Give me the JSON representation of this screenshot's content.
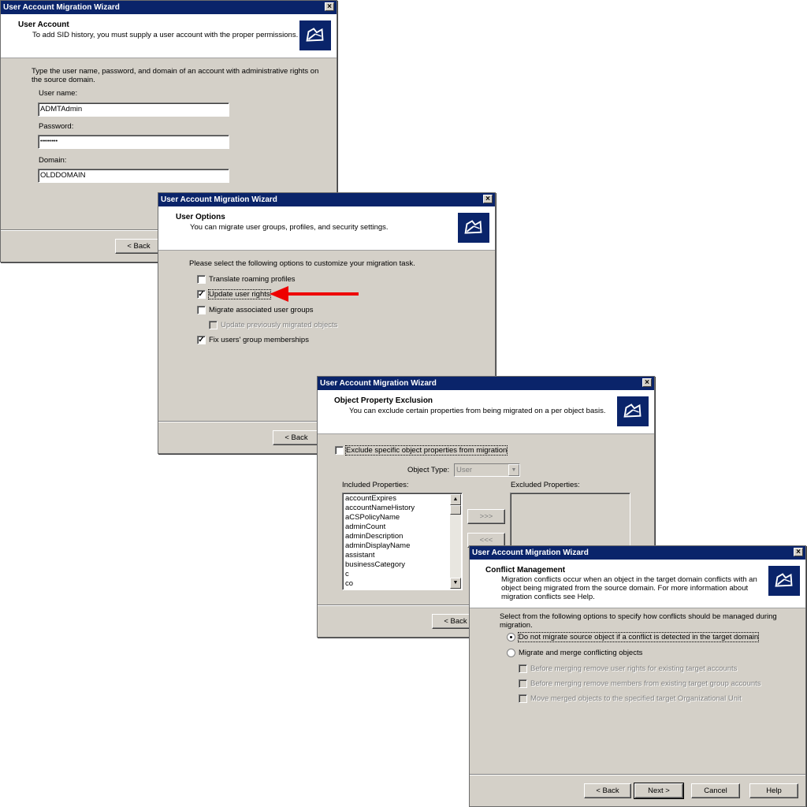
{
  "wizard_title": "User Account Migration Wizard",
  "close_glyph": "×",
  "accent_colors": {
    "titlebar": "#0a246a",
    "arrow": "#ee0000"
  },
  "win1": {
    "header_title": "User Account",
    "header_subtitle": "To add SID history, you must supply a user account with the proper permissions.",
    "instructions_line1": "Type the user name, password, and domain of an account with administrative rights on",
    "instructions_line2": "the source domain.",
    "username_label": "User name:",
    "username_value": "ADMTAdmin",
    "password_label": "Password:",
    "password_value": "•••••••••",
    "domain_label": "Domain:",
    "domain_value": "OLDDOMAIN",
    "back_label": "< Back"
  },
  "win2": {
    "header_title": "User Options",
    "header_subtitle": "You can migrate user groups, profiles, and security settings.",
    "instructions": "Please select the following options to customize your migration task.",
    "options": [
      {
        "label": "Translate roaming profiles",
        "checked": false
      },
      {
        "label": "Update user rights",
        "checked": true
      },
      {
        "label": "Migrate associated user groups",
        "checked": false
      },
      {
        "label": "Update previously migrated objects",
        "checked": false,
        "disabled": true
      },
      {
        "label": "Fix users' group memberships",
        "checked": true
      }
    ],
    "check_glyph": "✓",
    "back_label": "< Back"
  },
  "win3": {
    "header_title": "Object Property Exclusion",
    "header_subtitle": "You can exclude certain properties from being migrated on a per object basis.",
    "exclude_label": "Exclude specific object properties from migration",
    "object_type_label": "Object Type:",
    "object_type_value": "User",
    "included_label": "Included Properties:",
    "excluded_label": "Excluded Properties:",
    "included_properties": [
      "accountExpires",
      "accountNameHistory",
      "aCSPolicyName",
      "adminCount",
      "adminDescription",
      "adminDisplayName",
      "assistant",
      "businessCategory",
      "c",
      "co"
    ],
    "add_label": ">>>",
    "remove_label": "<<<",
    "back_label": "< Back"
  },
  "win4": {
    "header_title": "Conflict Management",
    "header_subtitle_line1": "Migration conflicts occur when an object in the target domain conflicts with an",
    "header_subtitle_line2": "object being migrated from the source domain. For more information about",
    "header_subtitle_line3": "migration conflicts see Help.",
    "instructions_line1": "Select from the following options to specify how conflicts should be managed during",
    "instructions_line2": "migration.",
    "radio_no_migrate": "Do not migrate source object if a conflict is detected in the target domain",
    "radio_merge": "Migrate and merge conflicting objects",
    "sub_options": [
      "Before merging remove user rights for existing target accounts",
      "Before merging remove members from existing target group accounts",
      "Move merged objects to the specified target Organizational Unit"
    ],
    "back_label": "< Back",
    "next_label": "Next >",
    "cancel_label": "Cancel",
    "help_label": "Help"
  }
}
